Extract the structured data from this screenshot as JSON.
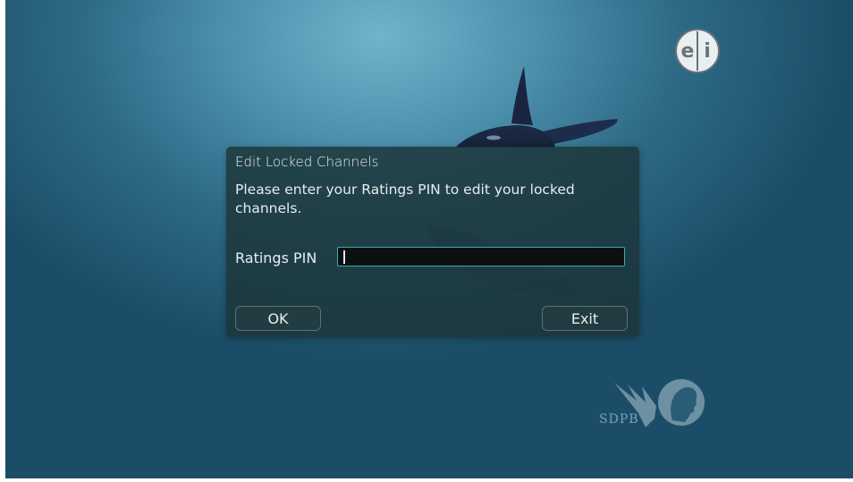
{
  "dialog": {
    "title": "Edit Locked Channels",
    "message": "Please enter your Ratings PIN to edit your locked channels.",
    "pin_label": "Ratings PIN",
    "pin_value": "",
    "ok_label": "OK",
    "exit_label": "Exit"
  },
  "badges": {
    "ei_letter_e": "e",
    "ei_letter_i": "i",
    "network_text": "SDPB"
  },
  "colors": {
    "dialog_background": "#1c3438",
    "input_border": "#3fa8b2",
    "input_background": "#0c0f10",
    "text": "#e6eef0",
    "water_light": "#6fb3cc",
    "water_dark": "#1c4d68"
  },
  "icons": {
    "ei_badge": "ei-rating-icon",
    "network_logo": "pbs-head-icon",
    "network_wings": "sdpb-wings-icon"
  }
}
